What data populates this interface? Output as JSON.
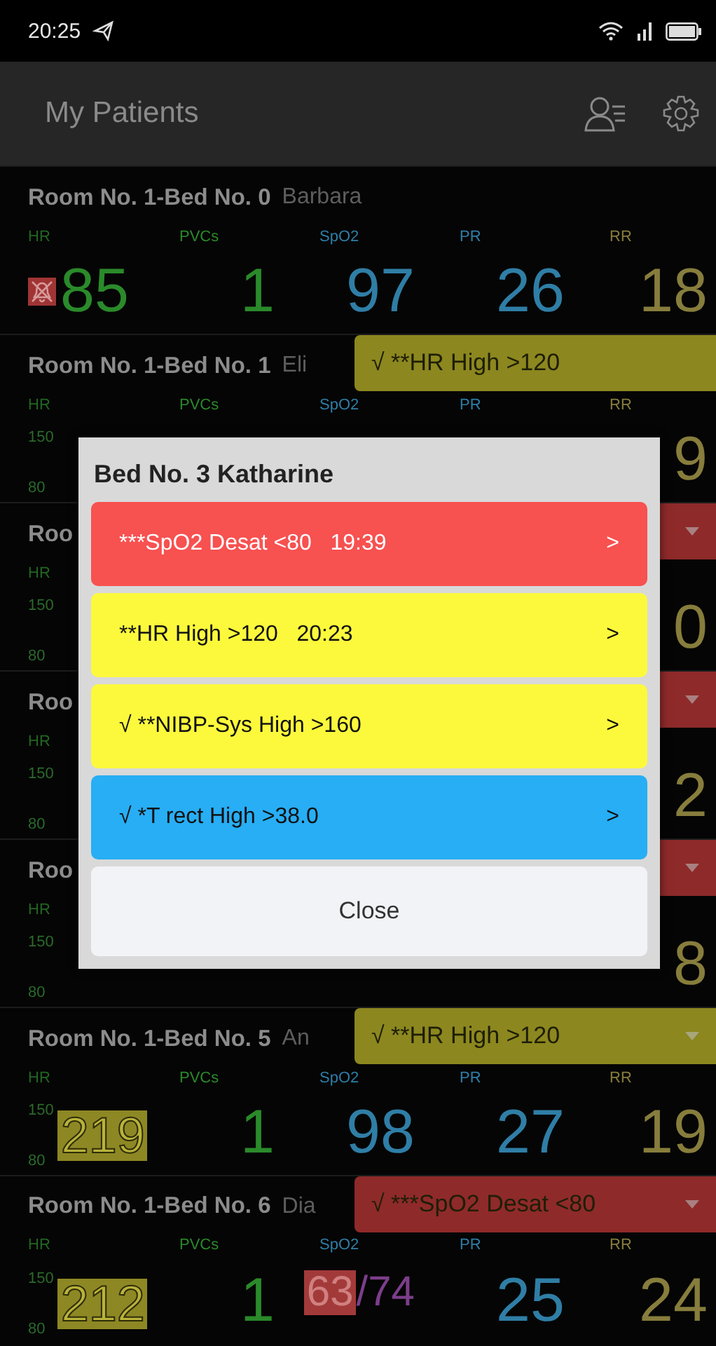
{
  "status_bar": {
    "time": "20:25"
  },
  "app_bar": {
    "title": "My Patients"
  },
  "rows": [
    {
      "room": "Room No. 1-Bed No. 0",
      "name": "Barbara",
      "hr": {
        "label": "HR",
        "alarm_off": true,
        "value": "85",
        "boxed": false
      },
      "metrics": [
        {
          "label": "PVCs",
          "value": "1",
          "color": "#2a8a2a"
        },
        {
          "label": "SpO2",
          "value": "97",
          "color": "#2f7ea6"
        },
        {
          "label": "PR",
          "value": "26",
          "color": "#2f7ea6"
        },
        {
          "label": "RR",
          "value": "18",
          "color": "#877d3c"
        }
      ]
    },
    {
      "room": "Room No. 1-Bed No. 1",
      "name": "Eli",
      "alert": {
        "text": "√ **HR High >120",
        "color": "#8c871f",
        "dropdown": false
      },
      "hr": {
        "label": "HR",
        "upper": "150",
        "lower": "80"
      },
      "metrics": [
        {
          "label": "PVCs",
          "color": "#2a8a2a"
        },
        {
          "label": "SpO2",
          "color": "#2f7ea6"
        },
        {
          "label": "PR",
          "color": "#2f7ea6"
        },
        {
          "label": "RR",
          "value": "9",
          "color": "#877d3c"
        }
      ]
    },
    {
      "room": "Roo",
      "alert": {
        "color": "#8e2a2a",
        "dropdown": true
      },
      "hr": {
        "label": "HR",
        "upper": "150",
        "lower": "80"
      },
      "metrics": [
        {
          "value": "0",
          "color": "#877d3c"
        }
      ]
    },
    {
      "room": "Roo",
      "alert": {
        "color": "#8e2a2a",
        "dropdown": true
      },
      "hr": {
        "label": "HR",
        "upper": "150",
        "lower": "80"
      },
      "metrics": [
        {
          "value": "2",
          "color": "#877d3c"
        }
      ]
    },
    {
      "room": "Roo",
      "alert": {
        "color": "#8e2a2a",
        "dropdown": true
      },
      "hr": {
        "label": "HR",
        "upper": "150",
        "lower": "80"
      },
      "metrics": [
        {
          "value": "8",
          "color": "#877d3c"
        }
      ]
    },
    {
      "room": "Room No. 1-Bed No. 5",
      "name": "An",
      "alert": {
        "text": "√ **HR High >120",
        "color": "#8c871f",
        "dropdown": true
      },
      "hr": {
        "label": "HR",
        "upper": "150",
        "lower": "80",
        "value": "219",
        "boxed": true
      },
      "metrics": [
        {
          "label": "PVCs",
          "value": "1",
          "color": "#2a8a2a"
        },
        {
          "label": "SpO2",
          "value": "98",
          "color": "#2f7ea6"
        },
        {
          "label": "PR",
          "value": "27",
          "color": "#2f7ea6"
        },
        {
          "label": "RR",
          "value": "19",
          "color": "#877d3c"
        }
      ]
    },
    {
      "room": "Room No. 1-Bed No. 6",
      "name": "Dia",
      "alert": {
        "text": "√ ***SpO2 Desat <80",
        "color": "#8e2a2a",
        "dropdown": true
      },
      "hr": {
        "label": "HR",
        "upper": "150",
        "lower": "80",
        "value": "212",
        "boxed": true
      },
      "metrics": [
        {
          "label": "PVCs",
          "value": "1",
          "color": "#2a8a2a"
        },
        {
          "label": "SpO2",
          "value": "63",
          "highlight": true,
          "extra": "/74",
          "color": "#2f7ea6"
        },
        {
          "label": "PR",
          "value": "25",
          "color": "#2f7ea6"
        },
        {
          "label": "RR",
          "value": "24",
          "color": "#877d3c"
        }
      ]
    }
  ],
  "dialog": {
    "title": "Bed No. 3 Katharine",
    "alarms": [
      {
        "text": "***SpO2 Desat <80   19:39",
        "color": "#f75150",
        "chevron": ">"
      },
      {
        "text": "**HR High >120   20:23",
        "color": "#fcf93c",
        "chevron": ">"
      },
      {
        "text": "√ **NIBP-Sys High >160",
        "color": "#fcf93c",
        "chevron": ">"
      },
      {
        "text": "√ *T rect High >38.0",
        "color": "#27aef5",
        "chevron": ">"
      }
    ],
    "close_button": "Close"
  }
}
